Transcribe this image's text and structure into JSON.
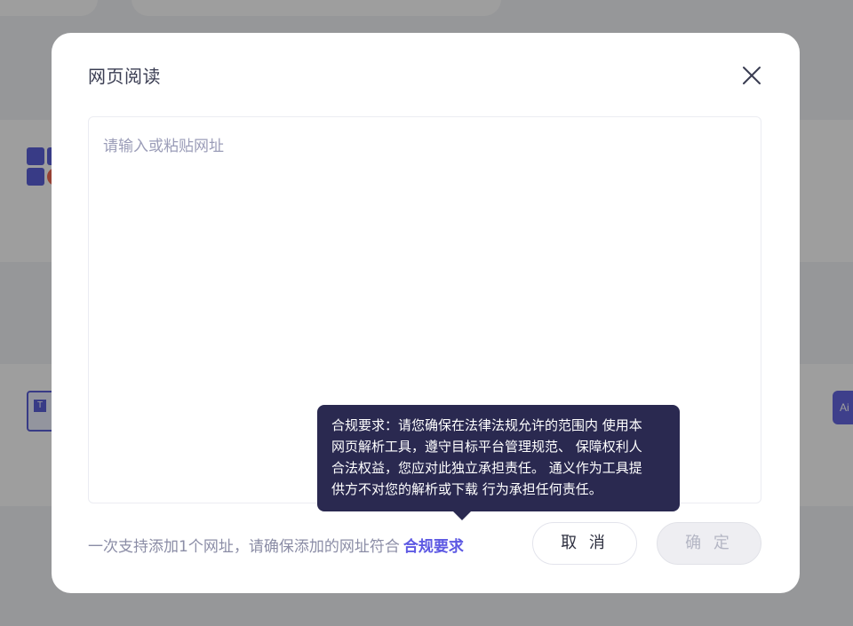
{
  "modal": {
    "title": "网页阅读",
    "close_icon": "close-icon",
    "input": {
      "placeholder": "请输入或粘贴网址",
      "value": ""
    },
    "tooltip": {
      "lines": [
        "合规要求：请您确保在法律法规允许的范围内 使用本",
        "网页解析工具，遵守目标平台管理规范、 保障权利人",
        "合法权益，您应对此独立承担责任。 通义作为工具提",
        "供方不对您的解析或下载 行为承担任何责任。"
      ]
    },
    "footer": {
      "note": "一次支持添加1个网址，请确保添加的网址符合",
      "link": "合规要求"
    },
    "buttons": {
      "cancel": "取 消",
      "confirm": "确 定"
    }
  },
  "background": {
    "icons": [
      "apps-grid-icon",
      "document-icon",
      "ai-icon"
    ],
    "ai_icon_text": "Ai"
  },
  "colors": {
    "accent": "#5d59e3",
    "tooltip_bg": "#2a2950",
    "overlay": "rgba(0,0,0,0.38)"
  }
}
